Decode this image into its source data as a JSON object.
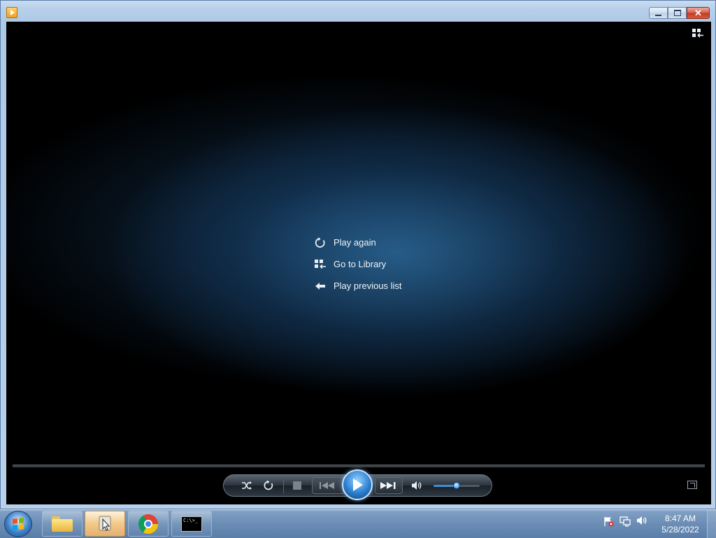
{
  "window": {
    "title": "",
    "caption": {
      "minimize": "",
      "maximize": "",
      "close": "✕"
    }
  },
  "video": {
    "menu": [
      {
        "label": "Play again",
        "icon": "replay-icon"
      },
      {
        "label": "Go to Library",
        "icon": "library-icon"
      },
      {
        "label": "Play previous list",
        "icon": "back-arrow-icon"
      }
    ]
  },
  "controls": {
    "shuffle": "shuffle-icon",
    "repeat": "repeat-icon",
    "stop": "stop-icon",
    "previous": "previous-icon",
    "play": "play-icon",
    "next": "next-icon",
    "mute": "speaker-icon",
    "volume_level": 0.5
  },
  "taskbar": {
    "apps": [
      "Windows Explorer",
      "Windows Media Player",
      "Google Chrome",
      "Command Prompt"
    ],
    "cmd_text": "C:\\>_",
    "clock_time": "8:47 AM",
    "clock_date": "5/28/2022"
  },
  "colors": {
    "accent": "#2a7fd0",
    "taskbar": "#6b8db5",
    "video_glow": "#285f8c"
  }
}
